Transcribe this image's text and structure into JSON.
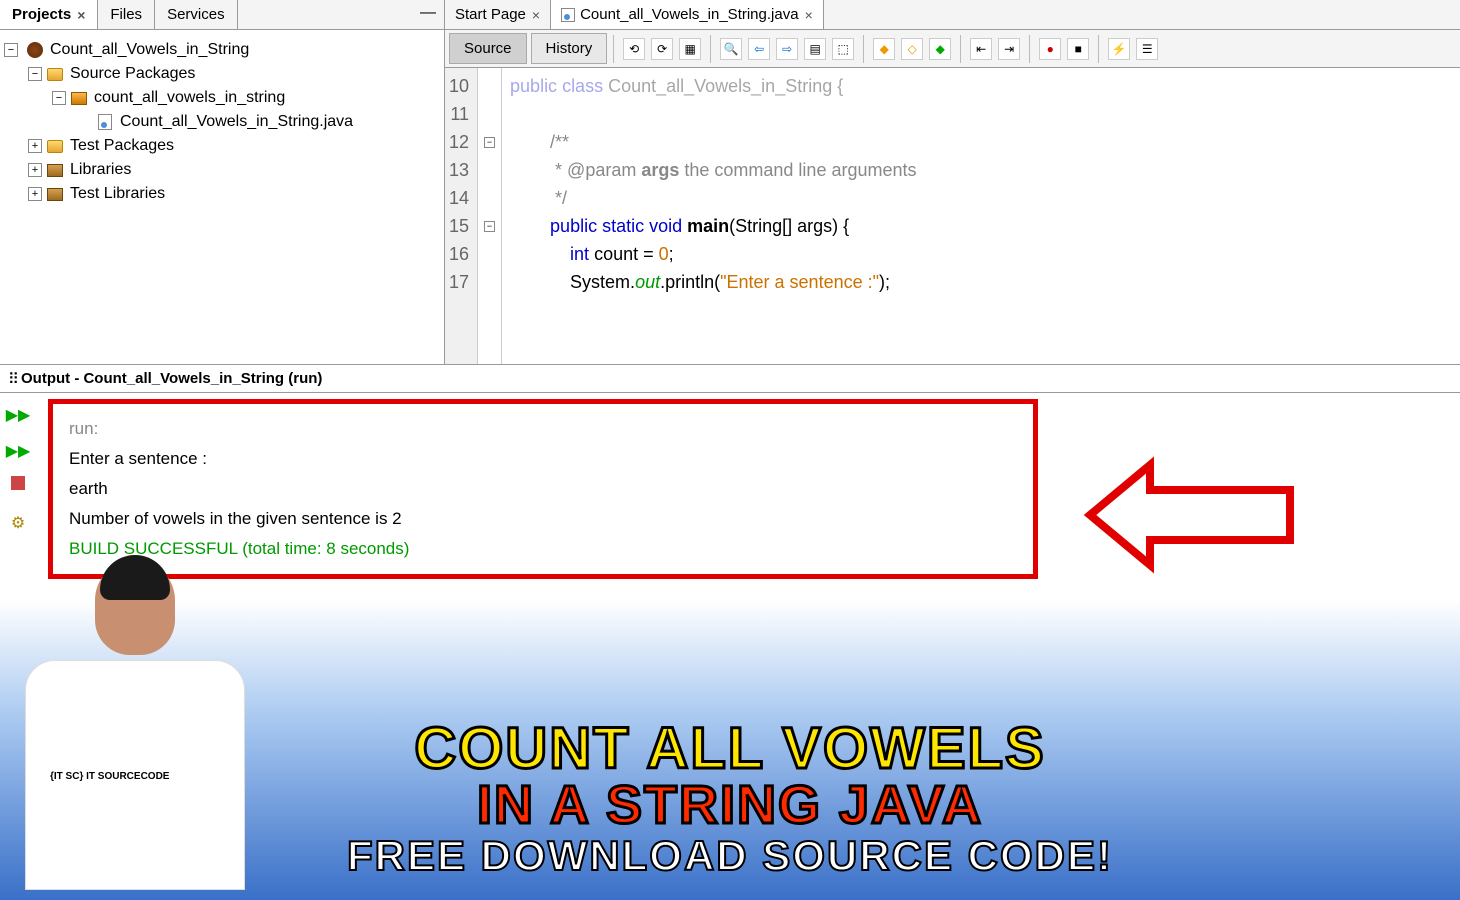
{
  "leftPanel": {
    "tabs": [
      "Projects",
      "Files",
      "Services"
    ],
    "tree": {
      "project": "Count_all_Vowels_in_String",
      "sourcePackages": "Source Packages",
      "package": "count_all_vowels_in_string",
      "javaFile": "Count_all_Vowels_in_String.java",
      "testPackages": "Test Packages",
      "libraries": "Libraries",
      "testLibraries": "Test Libraries"
    }
  },
  "editor": {
    "tabs": {
      "startPage": "Start Page",
      "file": "Count_all_Vowels_in_String.java"
    },
    "buttons": {
      "source": "Source",
      "history": "History"
    },
    "lineNumbers": [
      "10",
      "11",
      "12",
      "13",
      "14",
      "15",
      "16",
      "17"
    ],
    "code": {
      "l10a": "public class ",
      "l10b": "Count_all_Vowels_in_String {",
      "l11": "",
      "l12": "        /**",
      "l13a": "         * @param ",
      "l13b": "args",
      "l13c": " the command line arguments",
      "l14": "         */",
      "l15a": "        ",
      "l15b": "public static void ",
      "l15c": "main",
      "l15d": "(String[] args) {",
      "l16a": "            ",
      "l16b": "int",
      "l16c": " count = ",
      "l16d": "0",
      "l16e": ";",
      "l17a": "            System.",
      "l17b": "out",
      "l17c": ".println(",
      "l17d": "\"Enter a sentence :\"",
      "l17e": ");"
    }
  },
  "output": {
    "title": "Output - Count_all_Vowels_in_String (run)",
    "lines": {
      "run": "run:",
      "l1": "Enter a sentence :",
      "l2": "earth",
      "l3": "Number of vowels in the given sentence is 2",
      "build": "BUILD SUCCESSFUL (total time: 8 seconds)"
    }
  },
  "promo": {
    "shirtLogo": "{IT SC} IT SOURCECODE",
    "line1": "COUNT ALL VOWELS",
    "line2": "IN A STRING JAVA",
    "line3": "FREE DOWNLOAD SOURCE CODE!"
  }
}
